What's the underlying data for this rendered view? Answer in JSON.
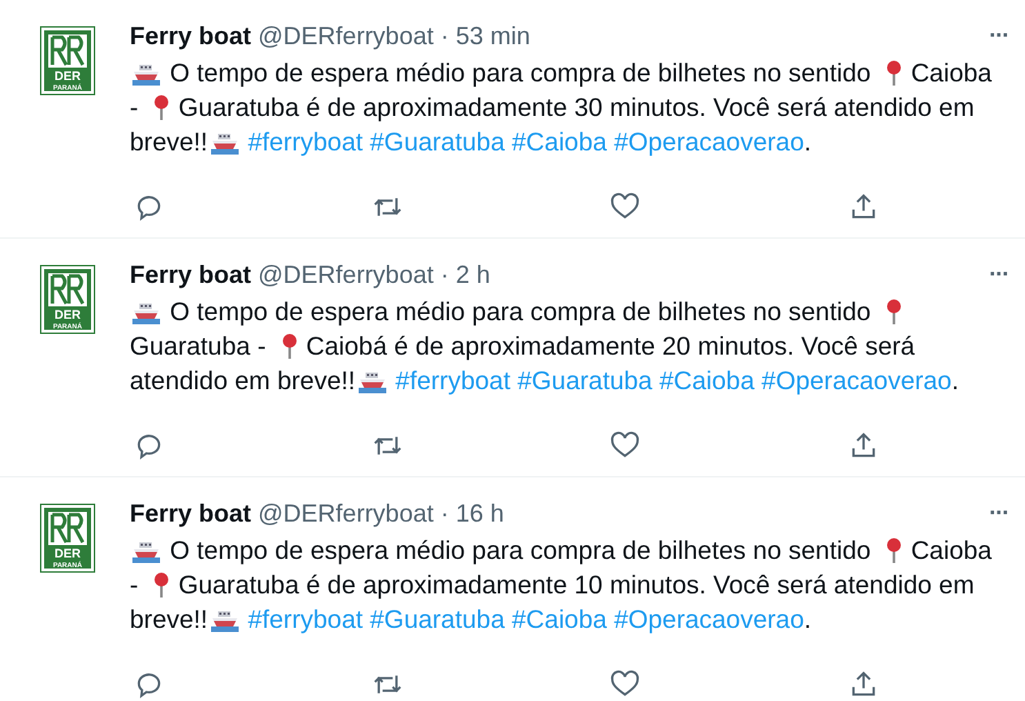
{
  "tweets": [
    {
      "avatar": {
        "mark": "DER",
        "region": "PARANÁ"
      },
      "name": "Ferry boat",
      "handle": "@DERferryboat",
      "separator": "·",
      "time": "53 min",
      "more": "···",
      "body": [
        {
          "kind": "ship"
        },
        {
          "kind": "text",
          "text": " O tempo de espera médio para compra de bilhetes no sentido "
        },
        {
          "kind": "pin"
        },
        {
          "kind": "text",
          "text": "Caioba - "
        },
        {
          "kind": "pin"
        },
        {
          "kind": "text",
          "text": "Guaratuba é de aproximadamente 30 minutos. Você será atendido em breve!!"
        },
        {
          "kind": "ship"
        },
        {
          "kind": "hashtag",
          "text": "#ferryboat"
        },
        {
          "kind": "hashtag",
          "text": "#Guaratuba"
        },
        {
          "kind": "hashtag",
          "text": "#Caioba"
        },
        {
          "kind": "hashtag",
          "text": "#Operacaoverao"
        },
        {
          "kind": "text",
          "text": "."
        }
      ]
    },
    {
      "avatar": {
        "mark": "DER",
        "region": "PARANÁ"
      },
      "name": "Ferry boat",
      "handle": "@DERferryboat",
      "separator": "·",
      "time": "2 h",
      "more": "···",
      "body": [
        {
          "kind": "ship"
        },
        {
          "kind": "text",
          "text": " O tempo de espera médio para compra de bilhetes no sentido "
        },
        {
          "kind": "pin"
        },
        {
          "kind": "text",
          "text": "Guaratuba - "
        },
        {
          "kind": "pin"
        },
        {
          "kind": "text",
          "text": "Caiobá é de aproximadamente 20 minutos. Você será atendido em breve!!"
        },
        {
          "kind": "ship"
        },
        {
          "kind": "hashtag",
          "text": "#ferryboat"
        },
        {
          "kind": "hashtag",
          "text": "#Guaratuba"
        },
        {
          "kind": "hashtag",
          "text": "#Caioba"
        },
        {
          "kind": "hashtag",
          "text": "#Operacaoverao"
        },
        {
          "kind": "text",
          "text": "."
        }
      ]
    },
    {
      "avatar": {
        "mark": "DER",
        "region": "PARANÁ"
      },
      "name": "Ferry boat",
      "handle": "@DERferryboat",
      "separator": "·",
      "time": "16 h",
      "more": "···",
      "body": [
        {
          "kind": "ship"
        },
        {
          "kind": "text",
          "text": " O tempo de espera médio para compra de bilhetes no sentido "
        },
        {
          "kind": "pin"
        },
        {
          "kind": "text",
          "text": "Caioba - "
        },
        {
          "kind": "pin"
        },
        {
          "kind": "text",
          "text": "Guaratuba é de aproximadamente 10 minutos. Você será atendido em breve!!"
        },
        {
          "kind": "ship"
        },
        {
          "kind": "hashtag",
          "text": "#ferryboat"
        },
        {
          "kind": "hashtag",
          "text": "#Guaratuba"
        },
        {
          "kind": "hashtag",
          "text": "#Caioba"
        },
        {
          "kind": "hashtag",
          "text": "#Operacaoverao"
        },
        {
          "kind": "text",
          "text": "."
        }
      ]
    }
  ]
}
